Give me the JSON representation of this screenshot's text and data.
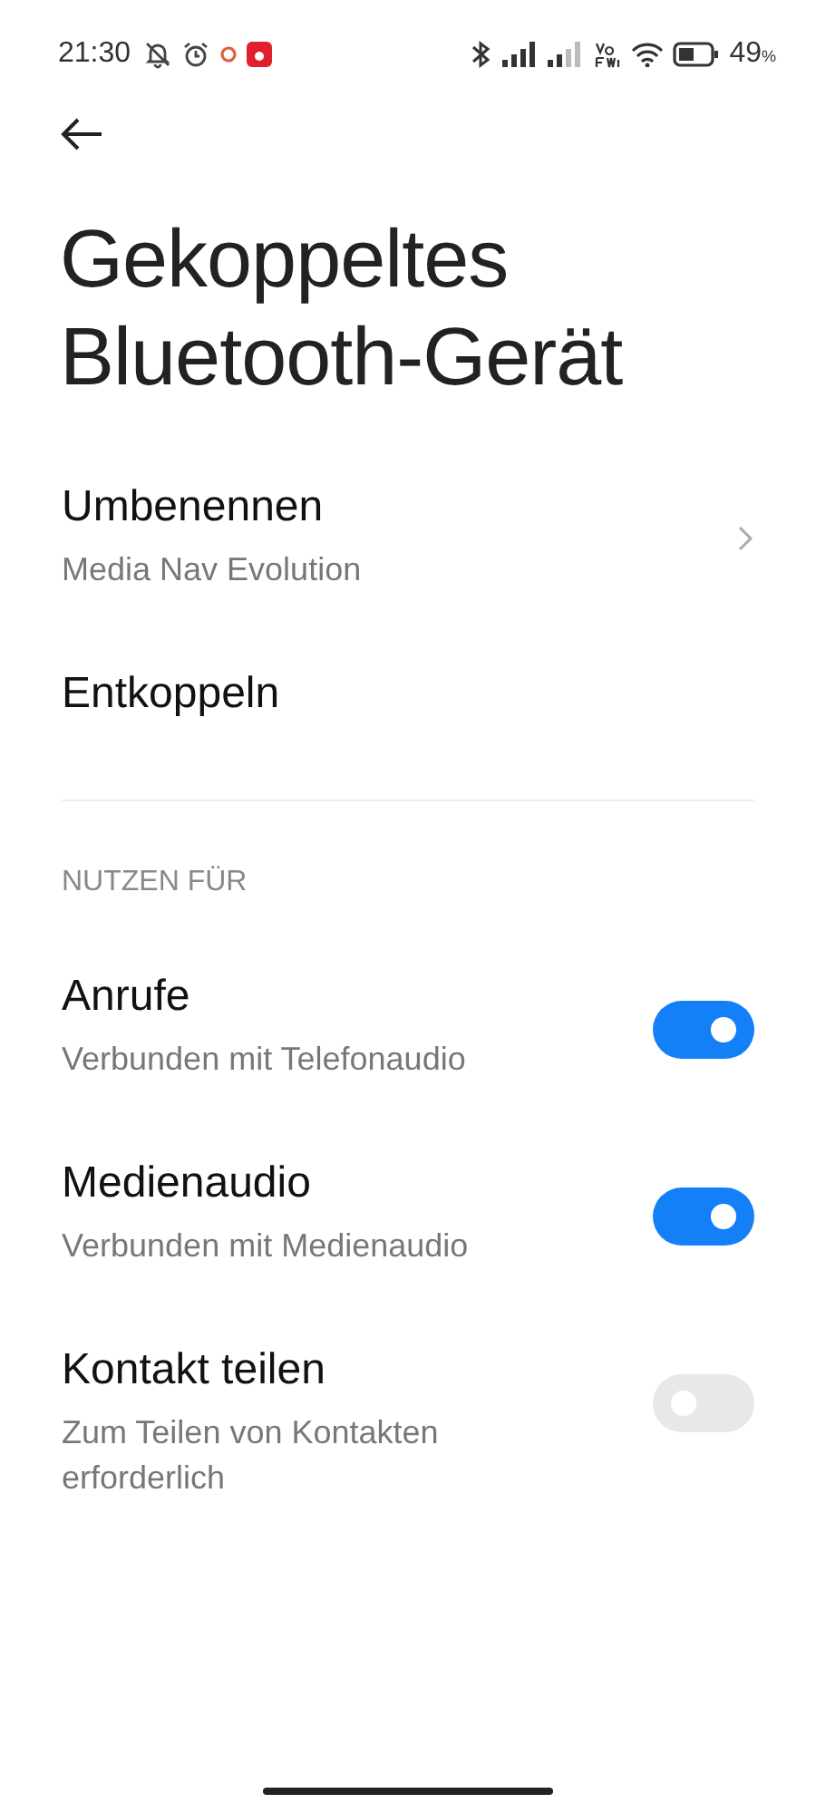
{
  "status_bar": {
    "time": "21:30",
    "battery": "49",
    "battery_unit": "%"
  },
  "title": "Gekoppeltes Bluetooth-Gerät",
  "actions": [
    {
      "label": "Umbenennen",
      "value": "Media Nav Evolution",
      "chevron": true
    },
    {
      "label": "Entkoppeln"
    }
  ],
  "section_header": "NUTZEN FÜR",
  "profiles": [
    {
      "label": "Anrufe",
      "description": "Verbunden mit Telefonaudio",
      "on": true
    },
    {
      "label": "Medienaudio",
      "description": "Verbunden mit Medienaudio",
      "on": true
    },
    {
      "label": "Kontakt teilen",
      "description": "Zum Teilen von Kontakten erforderlich",
      "on": false
    }
  ]
}
